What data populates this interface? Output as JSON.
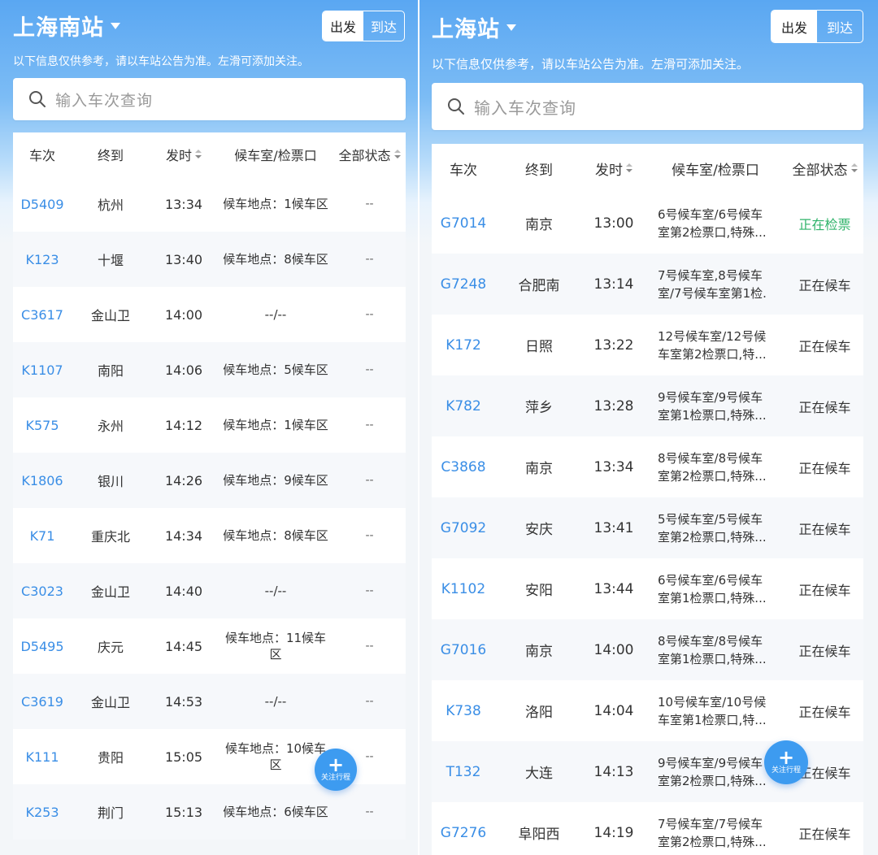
{
  "left": {
    "station": "上海南站",
    "toggle": {
      "depart": "出发",
      "arrive": "到达"
    },
    "notice": "以下信息仅供参考，请以车站公告为准。左滑可添加关注。",
    "search_placeholder": "输入车次查询",
    "columns": {
      "train": "车次",
      "dest": "终到",
      "time": "发时",
      "waiting": "候车室/检票口",
      "status": "全部状态"
    },
    "rows": [
      {
        "train": "D5409",
        "dest": "杭州",
        "time": "13:34",
        "waiting": "候车地点：1候车区",
        "status": "--"
      },
      {
        "train": "K123",
        "dest": "十堰",
        "time": "13:40",
        "waiting": "候车地点：8候车区",
        "status": "--"
      },
      {
        "train": "C3617",
        "dest": "金山卫",
        "time": "14:00",
        "waiting": "--/--",
        "status": "--"
      },
      {
        "train": "K1107",
        "dest": "南阳",
        "time": "14:06",
        "waiting": "候车地点：5候车区",
        "status": "--"
      },
      {
        "train": "K575",
        "dest": "永州",
        "time": "14:12",
        "waiting": "候车地点：1候车区",
        "status": "--"
      },
      {
        "train": "K1806",
        "dest": "银川",
        "time": "14:26",
        "waiting": "候车地点：9候车区",
        "status": "--"
      },
      {
        "train": "K71",
        "dest": "重庆北",
        "time": "14:34",
        "waiting": "候车地点：8候车区",
        "status": "--"
      },
      {
        "train": "C3023",
        "dest": "金山卫",
        "time": "14:40",
        "waiting": "--/--",
        "status": "--"
      },
      {
        "train": "D5495",
        "dest": "庆元",
        "time": "14:45",
        "waiting": "候车地点：11候车区",
        "status": "--"
      },
      {
        "train": "C3619",
        "dest": "金山卫",
        "time": "14:53",
        "waiting": "--/--",
        "status": "--"
      },
      {
        "train": "K111",
        "dest": "贵阳",
        "time": "15:05",
        "waiting": "候车地点：10候车区",
        "status": "--"
      },
      {
        "train": "K253",
        "dest": "荆门",
        "time": "15:13",
        "waiting": "候车地点：6候车区",
        "status": "--"
      }
    ],
    "fab_label": "关注行程"
  },
  "right": {
    "station": "上海站",
    "toggle": {
      "depart": "出发",
      "arrive": "到达"
    },
    "notice": "以下信息仅供参考，请以车站公告为准。左滑可添加关注。",
    "search_placeholder": "输入车次查询",
    "columns": {
      "train": "车次",
      "dest": "终到",
      "time": "发时",
      "waiting": "候车室/检票口",
      "status": "全部状态"
    },
    "rows": [
      {
        "train": "G7014",
        "dest": "南京",
        "time": "13:00",
        "waiting_line1": "6号候车室/6号候车",
        "waiting_line2": "室第2检票口,特殊...",
        "status": "正在检票"
      },
      {
        "train": "G7248",
        "dest": "合肥南",
        "time": "13:14",
        "waiting_line1": "7号候车室,8号候车",
        "waiting_line2": "室/7号候车室第1检.",
        "status": "正在候车"
      },
      {
        "train": "K172",
        "dest": "日照",
        "time": "13:22",
        "waiting_line1": "12号候车室/12号候",
        "waiting_line2": "车室第2检票口,特...",
        "status": "正在候车"
      },
      {
        "train": "K782",
        "dest": "萍乡",
        "time": "13:28",
        "waiting_line1": "9号候车室/9号候车",
        "waiting_line2": "室第1检票口,特殊...",
        "status": "正在候车"
      },
      {
        "train": "C3868",
        "dest": "南京",
        "time": "13:34",
        "waiting_line1": "8号候车室/8号候车",
        "waiting_line2": "室第2检票口,特殊...",
        "status": "正在候车"
      },
      {
        "train": "G7092",
        "dest": "安庆",
        "time": "13:41",
        "waiting_line1": "5号候车室/5号候车",
        "waiting_line2": "室第2检票口,特殊...",
        "status": "正在候车"
      },
      {
        "train": "K1102",
        "dest": "安阳",
        "time": "13:44",
        "waiting_line1": "6号候车室/6号候车",
        "waiting_line2": "室第1检票口,特殊...",
        "status": "正在候车"
      },
      {
        "train": "G7016",
        "dest": "南京",
        "time": "14:00",
        "waiting_line1": "8号候车室/8号候车",
        "waiting_line2": "室第1检票口,特殊...",
        "status": "正在候车"
      },
      {
        "train": "K738",
        "dest": "洛阳",
        "time": "14:04",
        "waiting_line1": "10号候车室/10号候",
        "waiting_line2": "车室第1检票口,特...",
        "status": "正在候车"
      },
      {
        "train": "T132",
        "dest": "大连",
        "time": "14:13",
        "waiting_line1": "9号候车室/9号候车",
        "waiting_line2": "室第2检票口,特殊...",
        "status": "正在候车"
      },
      {
        "train": "G7276",
        "dest": "阜阳西",
        "time": "14:19",
        "waiting_line1": "7号候车室/7号候车",
        "waiting_line2": "室第2检票口,特殊...",
        "status": "正在候车"
      }
    ],
    "fab_label": "关注行程"
  },
  "colors": {
    "accent": "#3a8ee6",
    "status_checking": "#2fb36a",
    "header_top": "#5aa7f2",
    "fab": "#3d9bf0"
  }
}
